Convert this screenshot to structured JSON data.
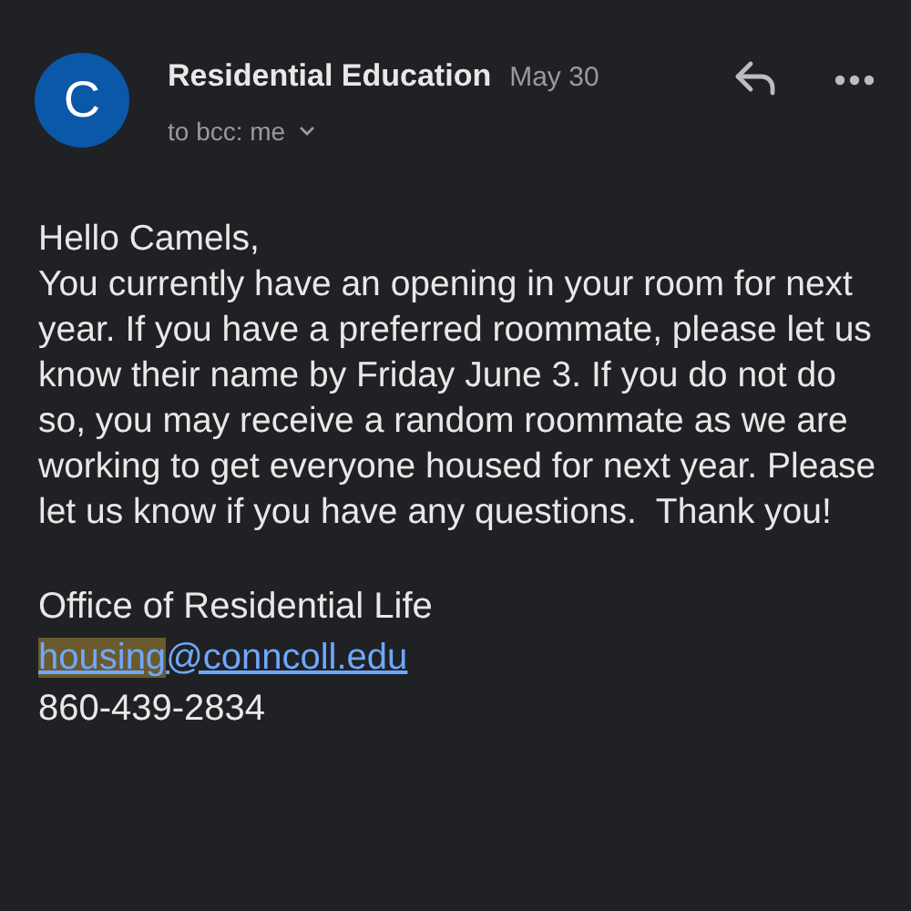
{
  "sender": {
    "initial": "C",
    "name": "Residential Education",
    "date": "May 30",
    "recipients": "to bcc: me"
  },
  "body": {
    "greeting": "Hello Camels,",
    "paragraph": "You currently have an opening in your room for next year. If you have a preferred roommate, please let us know their name by Friday June 3. If you do not do so, you may receive a random roommate as we are working to get everyone housed for next year. Please let us know if you have any questions.  Thank you!"
  },
  "signature": {
    "office": "Office of Residential Life",
    "email": [
      {
        "text": "housing",
        "highlighted": true
      },
      {
        "text": "@conncoll.edu",
        "highlighted": false
      }
    ],
    "phone": "860-439-2834"
  }
}
